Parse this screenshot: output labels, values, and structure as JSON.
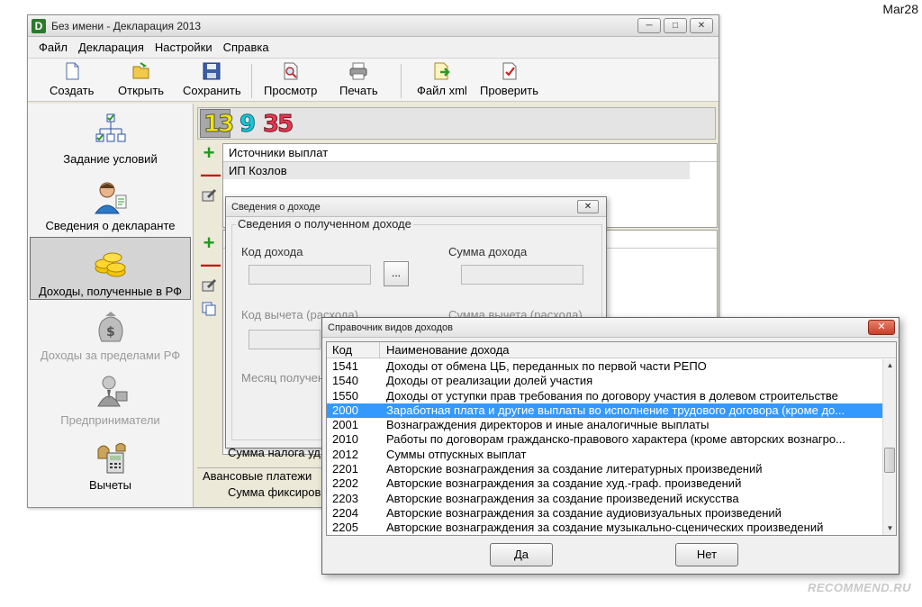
{
  "corner_date": "Mar28",
  "watermark": "RECOMMEND.RU",
  "window": {
    "title": "Без имени - Декларация 2013",
    "app_icon": "D"
  },
  "menu": [
    "Файл",
    "Декларация",
    "Настройки",
    "Справка"
  ],
  "toolbar": {
    "create": "Создать",
    "open": "Открыть",
    "save": "Сохранить",
    "preview": "Просмотр",
    "print": "Печать",
    "xml": "Файл xml",
    "check": "Проверить"
  },
  "sidebar": {
    "items": [
      {
        "label": "Задание условий",
        "icon": "tree-checklist-icon"
      },
      {
        "label": "Сведения о декларанте",
        "icon": "person-icon"
      },
      {
        "label": "Доходы, полученные в РФ",
        "icon": "coins-icon"
      },
      {
        "label": "Доходы за пределами РФ",
        "icon": "money-bag-icon"
      },
      {
        "label": "Предприниматели",
        "icon": "businessman-icon"
      },
      {
        "label": "Вычеты",
        "icon": "calculator-icon"
      }
    ]
  },
  "rates": [
    "13",
    "9",
    "35"
  ],
  "sources": {
    "header": "Источники выплат",
    "row": "ИП Козлов"
  },
  "bottom": {
    "tax_sum": "Сумма налога уд",
    "advance": "Авансовые платежи",
    "fixed_sum": "Сумма фиксиров"
  },
  "income_dialog": {
    "title": "Сведения о доходе",
    "group_title": "Сведения о полученном доходе",
    "code_label": "Код дохода",
    "browse_label": "...",
    "sum_label": "Сумма дохода",
    "deduction_code_label": "Код вычета (расхода)",
    "deduction_sum_label": "Сумма вычета (расхода)",
    "month_label": "Месяц получен"
  },
  "ref_dialog": {
    "title": "Справочник видов доходов",
    "col_code": "Код",
    "col_name": "Наименование дохода",
    "rows": [
      {
        "code": "1541",
        "name": "Доходы от обмена ЦБ, переданных по первой части РЕПО"
      },
      {
        "code": "1540",
        "name": "Доходы от реализации долей участия"
      },
      {
        "code": "1550",
        "name": "Доходы от уступки прав требования по договору участия в долевом строительстве"
      },
      {
        "code": "2000",
        "name": "Заработная плата и другие выплаты во исполнение трудового договора (кроме до..."
      },
      {
        "code": "2001",
        "name": "Вознаграждения директоров и иные аналогичные выплаты"
      },
      {
        "code": "2010",
        "name": "Работы по договорам гражданско-правового характера (кроме авторских вознагро..."
      },
      {
        "code": "2012",
        "name": "Суммы отпускных выплат"
      },
      {
        "code": "2201",
        "name": "Авторские вознаграждения за создание литературных произведений"
      },
      {
        "code": "2202",
        "name": "Авторские вознаграждения за создание худ.-граф. произведений"
      },
      {
        "code": "2203",
        "name": "Авторские вознаграждения за создание произведений искусства"
      },
      {
        "code": "2204",
        "name": "Авторские вознаграждения за создание аудиовизуальных произведений"
      },
      {
        "code": "2205",
        "name": "Авторские вознаграждения за создание музыкально-сценических произведений"
      }
    ],
    "yes_label": "Да",
    "no_label": "Нет"
  }
}
